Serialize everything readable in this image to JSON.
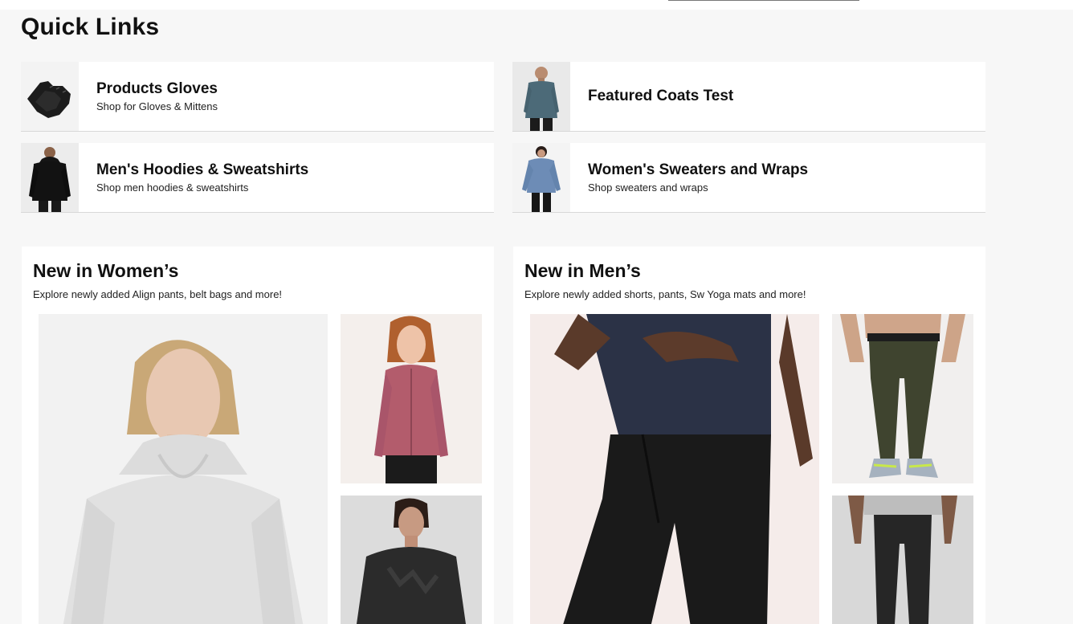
{
  "quick_links": {
    "title": "Quick Links",
    "items": [
      {
        "name": "Products Gloves",
        "subtitle": "Shop for Gloves & Mittens"
      },
      {
        "name": "Featured Coats Test",
        "subtitle": ""
      },
      {
        "name": "Men's Hoodies & Sweatshirts",
        "subtitle": "Shop men hoodies & sweatshirts"
      },
      {
        "name": "Women's Sweaters and Wraps",
        "subtitle": "Shop sweaters and wraps"
      }
    ]
  },
  "new_women": {
    "title": "New in Women’s",
    "subtitle": "Explore newly added Align pants, belt bags and more!"
  },
  "new_men": {
    "title": "New in Men’s",
    "subtitle": "Explore newly added shorts, pants, Sw Yoga mats and more!"
  },
  "colors": {
    "page_bg": "#f7f7f7",
    "card_bg": "#ffffff",
    "text": "#111111"
  }
}
